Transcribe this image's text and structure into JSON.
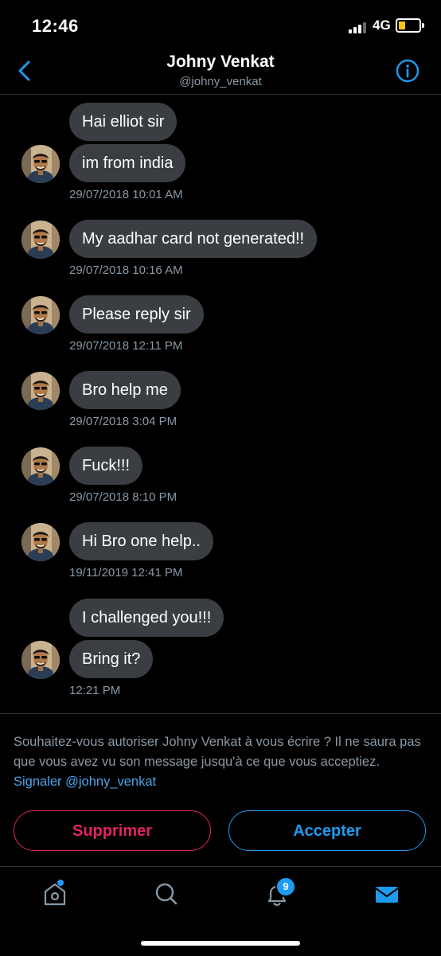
{
  "status_bar": {
    "time": "12:46",
    "network": "4G"
  },
  "header": {
    "title": "Johny Venkat",
    "handle": "@johny_venkat"
  },
  "messages": [
    {
      "bubbles": [
        "Hai elliot sir",
        "im from india"
      ],
      "timestamp": "29/07/2018 10:01 AM"
    },
    {
      "bubbles": [
        "My aadhar card not generated!!"
      ],
      "timestamp": "29/07/2018 10:16 AM"
    },
    {
      "bubbles": [
        "Please reply sir"
      ],
      "timestamp": "29/07/2018 12:11 PM"
    },
    {
      "bubbles": [
        "Bro help me"
      ],
      "timestamp": "29/07/2018 3:04 PM"
    },
    {
      "bubbles": [
        "Fuck!!!"
      ],
      "timestamp": "29/07/2018 8:10 PM"
    },
    {
      "bubbles": [
        "Hi Bro one help.."
      ],
      "timestamp": "19/11/2019 12:41 PM"
    },
    {
      "bubbles": [
        "I challenged you!!!",
        "Bring it?"
      ],
      "timestamp": "12:21 PM"
    }
  ],
  "request": {
    "text": "Souhaitez-vous autoriser Johny Venkat à vous écrire ? Il ne saura pas que vous avez vu son message jusqu'à ce que vous acceptiez.",
    "report_link": "Signaler @johny_venkat",
    "delete_label": "Supprimer",
    "accept_label": "Accepter"
  },
  "tab_bar": {
    "items": [
      "home-icon",
      "search-icon",
      "notifications-icon",
      "messages-icon"
    ],
    "notification_count": "9"
  },
  "colors": {
    "accent": "#1d9bf0",
    "danger": "#e0245e",
    "bubble": "#3a3d41",
    "muted": "#8899a6"
  }
}
